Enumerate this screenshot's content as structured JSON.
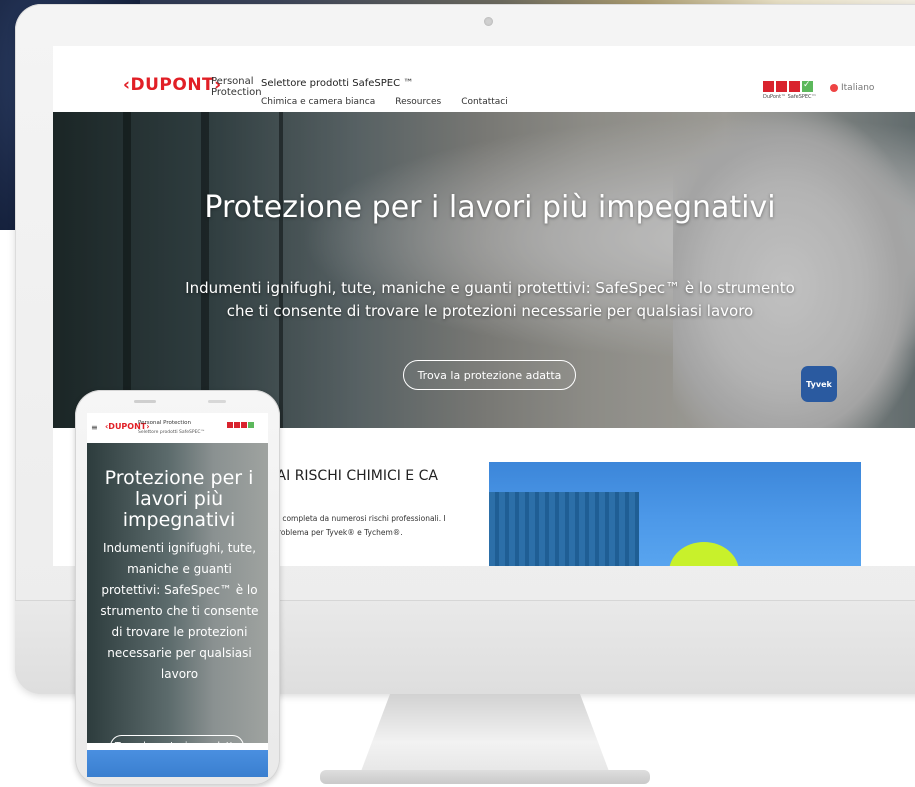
{
  "site": {
    "logo": "‹DUPONT›",
    "brand_line1": "Personal",
    "brand_line2": "Protection",
    "selector_title": "Selettore prodotti SafeSPEC ™",
    "nav": [
      "Chimica e camera bianca",
      "Resources",
      "Contattaci"
    ],
    "badge_caption": "DuPont™ SafeSPEC™",
    "language": "Italiano"
  },
  "hero": {
    "title": "Protezione per i lavori più impegnativi",
    "subtitle": "Indumenti ignifughi, tute, maniche e guanti protettivi: SafeSpec™ è lo strumento che ti consente di trovare le protezioni necessarie per qualsiasi lavoro",
    "cta": "Trova la protezione adatta",
    "tag": "Tyvek"
  },
  "section": {
    "title": "DAI RISCHI CHIMICI E CA",
    "line1": "one completa da numerosi rischi professionali. I",
    "line2": "n problema per Tyvek® e Tychem®."
  },
  "mobile": {
    "logo": "‹DUPONT›",
    "brand": "Personal Protection",
    "selector_title": "Selettore prodotti SafeSPEC™",
    "hero_title": "Protezione per i lavori più impegnativi",
    "hero_subtitle": "Indumenti ignifughi, tute, maniche e guanti protettivi: SafeSpec™ è lo strumento che ti consente di trovare le protezioni necessarie per qualsiasi lavoro",
    "cta": "Trova la protezione adatta",
    "menu_icon": "≡"
  },
  "colors": {
    "brand_red": "#e11f26",
    "check_green": "#5cb85c",
    "sky_blue": "#4c98e8"
  },
  "icons": [
    "hamburger-menu-icon",
    "check-icon",
    "flag-icon"
  ]
}
